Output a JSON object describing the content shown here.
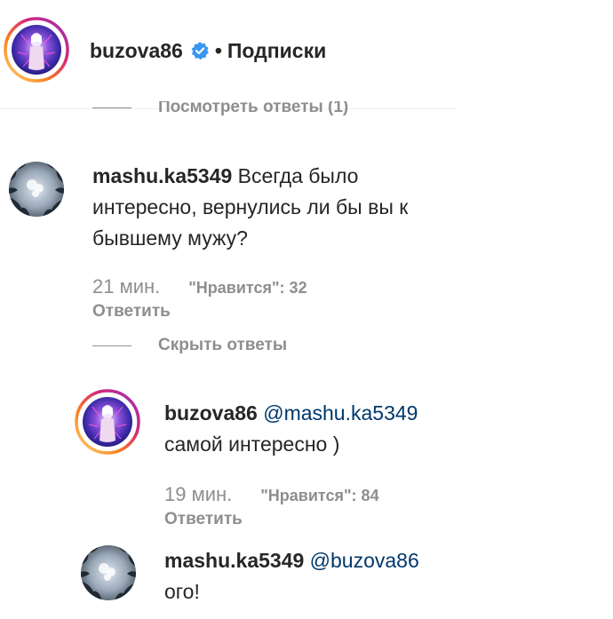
{
  "header": {
    "username": "buzova86",
    "separator": "•",
    "follow_label": "Подписки"
  },
  "thread_toggle_top": {
    "label": "Посмотреть ответы (1)"
  },
  "comments": [
    {
      "username": "mashu.ka5349",
      "text_line1": " Всегда было",
      "text_line2": "интересно, вернулись ли бы вы к",
      "text_line3": "бывшему мужу?",
      "time": "21 мин.",
      "likes": "\"Нравится\": 32",
      "reply_label": "Ответить"
    }
  ],
  "thread_toggle_hide": {
    "label": "Скрыть ответы"
  },
  "replies": [
    {
      "username": "buzova86",
      "mention": "@mashu.ka5349",
      "text": "самой интересно )",
      "time": "19 мин.",
      "likes": "\"Нравится\": 84",
      "reply_label": "Ответить"
    },
    {
      "username": "mashu.ka5349",
      "mention": "@buzova86",
      "text": "ого!"
    }
  ],
  "colors": {
    "text_primary": "#262626",
    "text_secondary": "#8e8e8e",
    "mention": "#00376b",
    "verified": "#3897f0",
    "story_ring_start": "#feda75",
    "story_ring_mid": "#d62976",
    "story_ring_end": "#962fbf"
  },
  "icons": {
    "verified": "verified-badge-icon"
  }
}
